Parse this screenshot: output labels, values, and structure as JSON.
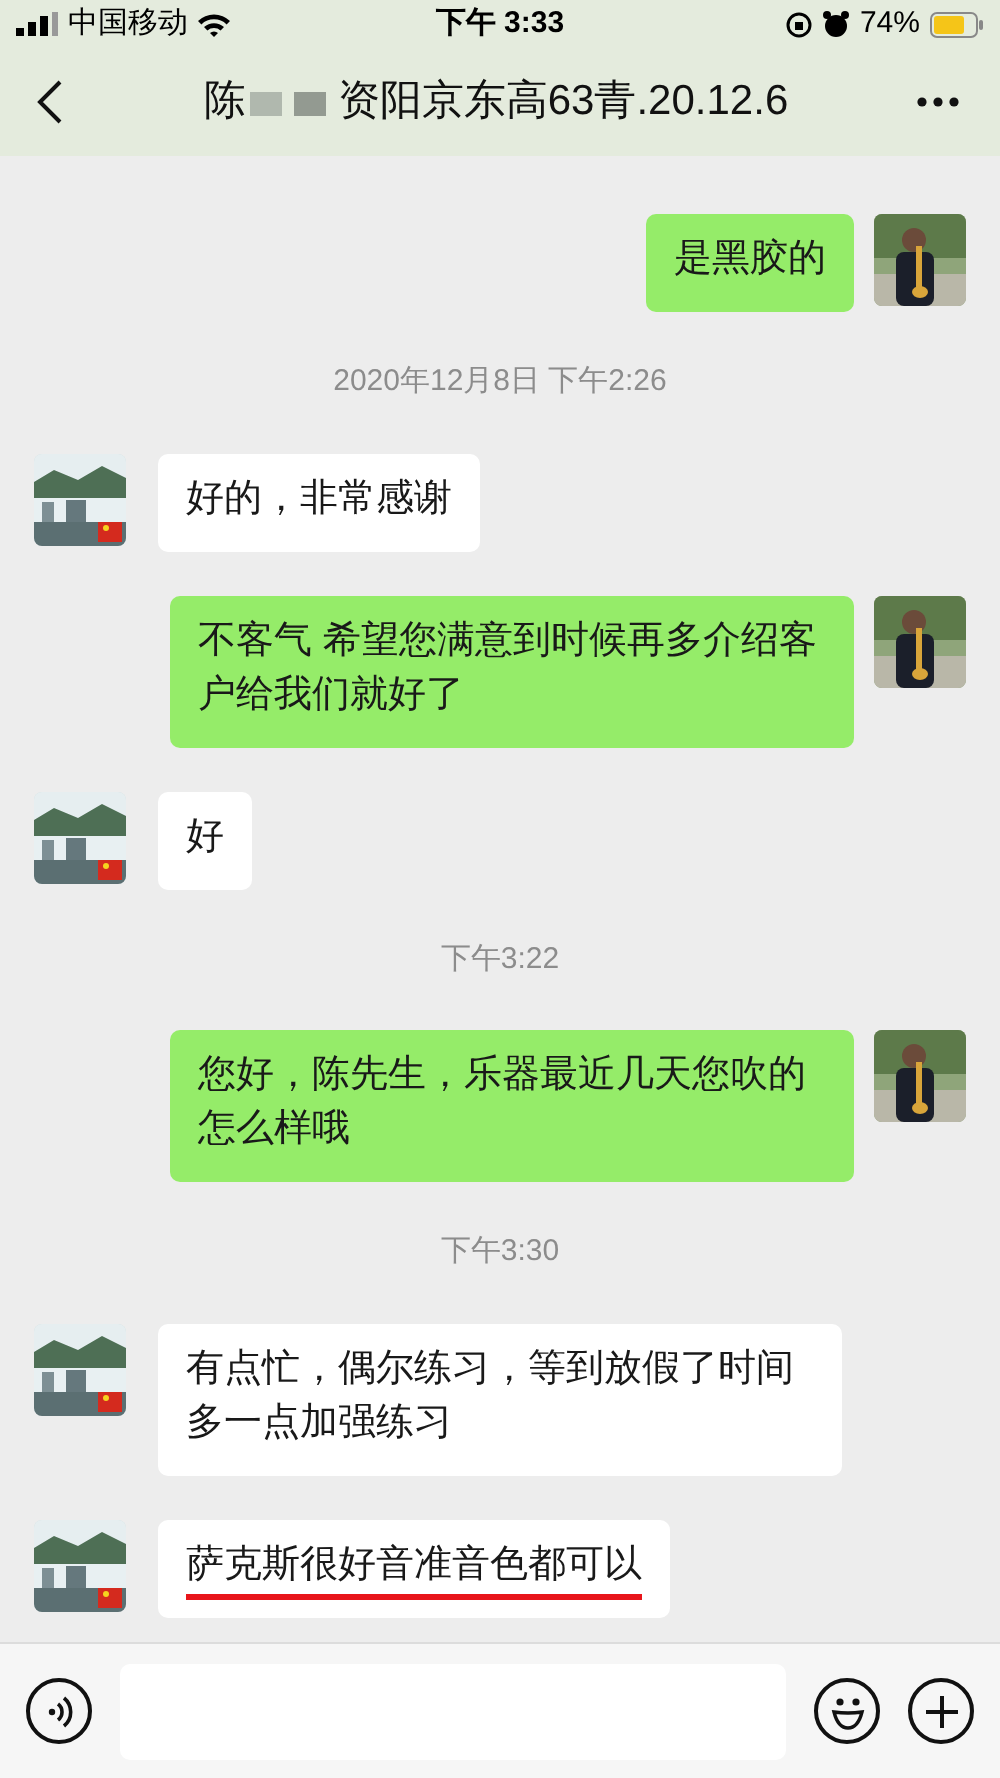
{
  "status_bar": {
    "carrier": "中国移动",
    "time": "下午 3:33",
    "battery": "74%"
  },
  "nav": {
    "title_start": "陈",
    "title_end": "资阳京东高63青.20.12.6"
  },
  "messages": [
    {
      "kind": "sent",
      "text": "是黑胶的",
      "underlined": false
    },
    {
      "kind": "time",
      "text": "2020年12月8日 下午2:26"
    },
    {
      "kind": "received",
      "text": "好的，非常感谢",
      "underlined": false
    },
    {
      "kind": "sent",
      "text": "不客气  希望您满意到时候再多介绍客户给我们就好了",
      "underlined": false
    },
    {
      "kind": "received",
      "text": "好",
      "underlined": false
    },
    {
      "kind": "time",
      "text": "下午3:22"
    },
    {
      "kind": "sent",
      "text": "您好，陈先生，乐器最近几天您吹的怎么样哦",
      "underlined": false
    },
    {
      "kind": "time",
      "text": "下午3:30"
    },
    {
      "kind": "received",
      "text": "有点忙，偶尔练习，等到放假了时间多一点加强练习",
      "underlined": false
    },
    {
      "kind": "received",
      "text": "萨克斯很好音准音色都可以",
      "underlined": true
    }
  ]
}
